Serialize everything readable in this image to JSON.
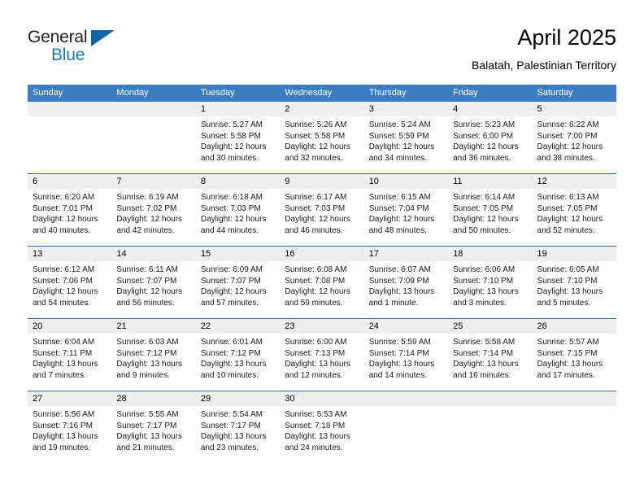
{
  "brand": {
    "name_part1": "General",
    "name_part2": "Blue",
    "logo_icon": "triangle-flag-icon",
    "color_dark": "#231f20",
    "color_blue": "#1878be"
  },
  "header": {
    "title": "April 2025",
    "subtitle": "Balatah, Palestinian Territory"
  },
  "theme": {
    "header_bg": "#3b7dbf",
    "week_rule": "#2f6da8",
    "daynum_band": "#efefef"
  },
  "calendar": {
    "weekday_headers": [
      "Sunday",
      "Monday",
      "Tuesday",
      "Wednesday",
      "Thursday",
      "Friday",
      "Saturday"
    ],
    "weeks": [
      [
        {
          "day": "",
          "sunrise": "",
          "sunset": "",
          "daylight_line1": "",
          "daylight_line2": ""
        },
        {
          "day": "",
          "sunrise": "",
          "sunset": "",
          "daylight_line1": "",
          "daylight_line2": ""
        },
        {
          "day": "1",
          "sunrise": "Sunrise: 5:27 AM",
          "sunset": "Sunset: 5:58 PM",
          "daylight_line1": "Daylight: 12 hours",
          "daylight_line2": "and 30 minutes."
        },
        {
          "day": "2",
          "sunrise": "Sunrise: 5:26 AM",
          "sunset": "Sunset: 5:58 PM",
          "daylight_line1": "Daylight: 12 hours",
          "daylight_line2": "and 32 minutes."
        },
        {
          "day": "3",
          "sunrise": "Sunrise: 5:24 AM",
          "sunset": "Sunset: 5:59 PM",
          "daylight_line1": "Daylight: 12 hours",
          "daylight_line2": "and 34 minutes."
        },
        {
          "day": "4",
          "sunrise": "Sunrise: 5:23 AM",
          "sunset": "Sunset: 6:00 PM",
          "daylight_line1": "Daylight: 12 hours",
          "daylight_line2": "and 36 minutes."
        },
        {
          "day": "5",
          "sunrise": "Sunrise: 6:22 AM",
          "sunset": "Sunset: 7:00 PM",
          "daylight_line1": "Daylight: 12 hours",
          "daylight_line2": "and 38 minutes."
        }
      ],
      [
        {
          "day": "6",
          "sunrise": "Sunrise: 6:20 AM",
          "sunset": "Sunset: 7:01 PM",
          "daylight_line1": "Daylight: 12 hours",
          "daylight_line2": "and 40 minutes."
        },
        {
          "day": "7",
          "sunrise": "Sunrise: 6:19 AM",
          "sunset": "Sunset: 7:02 PM",
          "daylight_line1": "Daylight: 12 hours",
          "daylight_line2": "and 42 minutes."
        },
        {
          "day": "8",
          "sunrise": "Sunrise: 6:18 AM",
          "sunset": "Sunset: 7:03 PM",
          "daylight_line1": "Daylight: 12 hours",
          "daylight_line2": "and 44 minutes."
        },
        {
          "day": "9",
          "sunrise": "Sunrise: 6:17 AM",
          "sunset": "Sunset: 7:03 PM",
          "daylight_line1": "Daylight: 12 hours",
          "daylight_line2": "and 46 minutes."
        },
        {
          "day": "10",
          "sunrise": "Sunrise: 6:15 AM",
          "sunset": "Sunset: 7:04 PM",
          "daylight_line1": "Daylight: 12 hours",
          "daylight_line2": "and 48 minutes."
        },
        {
          "day": "11",
          "sunrise": "Sunrise: 6:14 AM",
          "sunset": "Sunset: 7:05 PM",
          "daylight_line1": "Daylight: 12 hours",
          "daylight_line2": "and 50 minutes."
        },
        {
          "day": "12",
          "sunrise": "Sunrise: 6:13 AM",
          "sunset": "Sunset: 7:05 PM",
          "daylight_line1": "Daylight: 12 hours",
          "daylight_line2": "and 52 minutes."
        }
      ],
      [
        {
          "day": "13",
          "sunrise": "Sunrise: 6:12 AM",
          "sunset": "Sunset: 7:06 PM",
          "daylight_line1": "Daylight: 12 hours",
          "daylight_line2": "and 54 minutes."
        },
        {
          "day": "14",
          "sunrise": "Sunrise: 6:11 AM",
          "sunset": "Sunset: 7:07 PM",
          "daylight_line1": "Daylight: 12 hours",
          "daylight_line2": "and 56 minutes."
        },
        {
          "day": "15",
          "sunrise": "Sunrise: 6:09 AM",
          "sunset": "Sunset: 7:07 PM",
          "daylight_line1": "Daylight: 12 hours",
          "daylight_line2": "and 57 minutes."
        },
        {
          "day": "16",
          "sunrise": "Sunrise: 6:08 AM",
          "sunset": "Sunset: 7:08 PM",
          "daylight_line1": "Daylight: 12 hours",
          "daylight_line2": "and 59 minutes."
        },
        {
          "day": "17",
          "sunrise": "Sunrise: 6:07 AM",
          "sunset": "Sunset: 7:09 PM",
          "daylight_line1": "Daylight: 13 hours",
          "daylight_line2": "and 1 minute."
        },
        {
          "day": "18",
          "sunrise": "Sunrise: 6:06 AM",
          "sunset": "Sunset: 7:10 PM",
          "daylight_line1": "Daylight: 13 hours",
          "daylight_line2": "and 3 minutes."
        },
        {
          "day": "19",
          "sunrise": "Sunrise: 6:05 AM",
          "sunset": "Sunset: 7:10 PM",
          "daylight_line1": "Daylight: 13 hours",
          "daylight_line2": "and 5 minutes."
        }
      ],
      [
        {
          "day": "20",
          "sunrise": "Sunrise: 6:04 AM",
          "sunset": "Sunset: 7:11 PM",
          "daylight_line1": "Daylight: 13 hours",
          "daylight_line2": "and 7 minutes."
        },
        {
          "day": "21",
          "sunrise": "Sunrise: 6:03 AM",
          "sunset": "Sunset: 7:12 PM",
          "daylight_line1": "Daylight: 13 hours",
          "daylight_line2": "and 9 minutes."
        },
        {
          "day": "22",
          "sunrise": "Sunrise: 6:01 AM",
          "sunset": "Sunset: 7:12 PM",
          "daylight_line1": "Daylight: 13 hours",
          "daylight_line2": "and 10 minutes."
        },
        {
          "day": "23",
          "sunrise": "Sunrise: 6:00 AM",
          "sunset": "Sunset: 7:13 PM",
          "daylight_line1": "Daylight: 13 hours",
          "daylight_line2": "and 12 minutes."
        },
        {
          "day": "24",
          "sunrise": "Sunrise: 5:59 AM",
          "sunset": "Sunset: 7:14 PM",
          "daylight_line1": "Daylight: 13 hours",
          "daylight_line2": "and 14 minutes."
        },
        {
          "day": "25",
          "sunrise": "Sunrise: 5:58 AM",
          "sunset": "Sunset: 7:14 PM",
          "daylight_line1": "Daylight: 13 hours",
          "daylight_line2": "and 16 minutes."
        },
        {
          "day": "26",
          "sunrise": "Sunrise: 5:57 AM",
          "sunset": "Sunset: 7:15 PM",
          "daylight_line1": "Daylight: 13 hours",
          "daylight_line2": "and 17 minutes."
        }
      ],
      [
        {
          "day": "27",
          "sunrise": "Sunrise: 5:56 AM",
          "sunset": "Sunset: 7:16 PM",
          "daylight_line1": "Daylight: 13 hours",
          "daylight_line2": "and 19 minutes."
        },
        {
          "day": "28",
          "sunrise": "Sunrise: 5:55 AM",
          "sunset": "Sunset: 7:17 PM",
          "daylight_line1": "Daylight: 13 hours",
          "daylight_line2": "and 21 minutes."
        },
        {
          "day": "29",
          "sunrise": "Sunrise: 5:54 AM",
          "sunset": "Sunset: 7:17 PM",
          "daylight_line1": "Daylight: 13 hours",
          "daylight_line2": "and 23 minutes."
        },
        {
          "day": "30",
          "sunrise": "Sunrise: 5:53 AM",
          "sunset": "Sunset: 7:18 PM",
          "daylight_line1": "Daylight: 13 hours",
          "daylight_line2": "and 24 minutes."
        },
        {
          "day": "",
          "sunrise": "",
          "sunset": "",
          "daylight_line1": "",
          "daylight_line2": ""
        },
        {
          "day": "",
          "sunrise": "",
          "sunset": "",
          "daylight_line1": "",
          "daylight_line2": ""
        },
        {
          "day": "",
          "sunrise": "",
          "sunset": "",
          "daylight_line1": "",
          "daylight_line2": ""
        }
      ]
    ]
  }
}
